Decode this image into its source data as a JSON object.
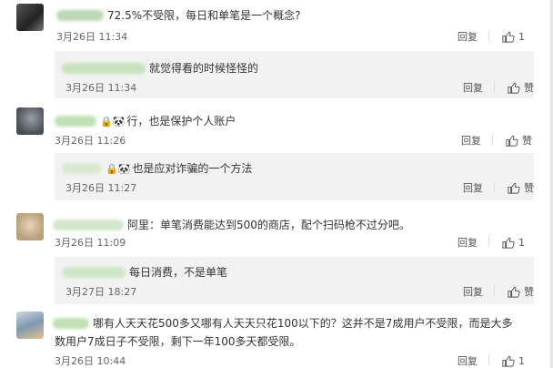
{
  "comments": [
    {
      "text": "72.5%不受限，每日和单笔是一个概念?",
      "time": "3月26日 11:34",
      "reply_label": "回复",
      "like_count": "1",
      "reply": {
        "text": "就觉得看的时候怪怪的",
        "time": "3月26日 11:34",
        "reply_label": "回复",
        "like_label": "赞"
      }
    },
    {
      "text": "行，也是保护个人账户",
      "time": "3月26日 11:26",
      "reply_label": "回复",
      "like_label": "赞",
      "reply": {
        "text": "也是应对诈骗的一个方法",
        "time": "3月26日 11:27",
        "reply_label": "回复",
        "like_label": "赞"
      }
    },
    {
      "text": "阿里：单笔消费能达到500的商店，配个扫码枪不过分吧。",
      "time": "3月26日 11:09",
      "reply_label": "回复",
      "like_count": "1",
      "reply": {
        "text": "每日消费，不是单笔",
        "time": "3月27日 18:27",
        "reply_label": "回复",
        "like_label": "赞"
      }
    },
    {
      "text_line1": "哪有人天天花500多又哪有人天天只花100以下的？这并不是7成用户不受限，而是大多",
      "text_line2": "数用户7成日子不受限，剩下一年100多天都受限。",
      "time": "3月26日 10:44",
      "reply_label": "回复",
      "like_count": "1"
    }
  ],
  "colors": {
    "background": "#ffffff",
    "reply_bg": "#f2f2f2",
    "text": "#333333",
    "meta": "#666666"
  },
  "icons": [
    "thumb-up-icon",
    "avatar"
  ]
}
